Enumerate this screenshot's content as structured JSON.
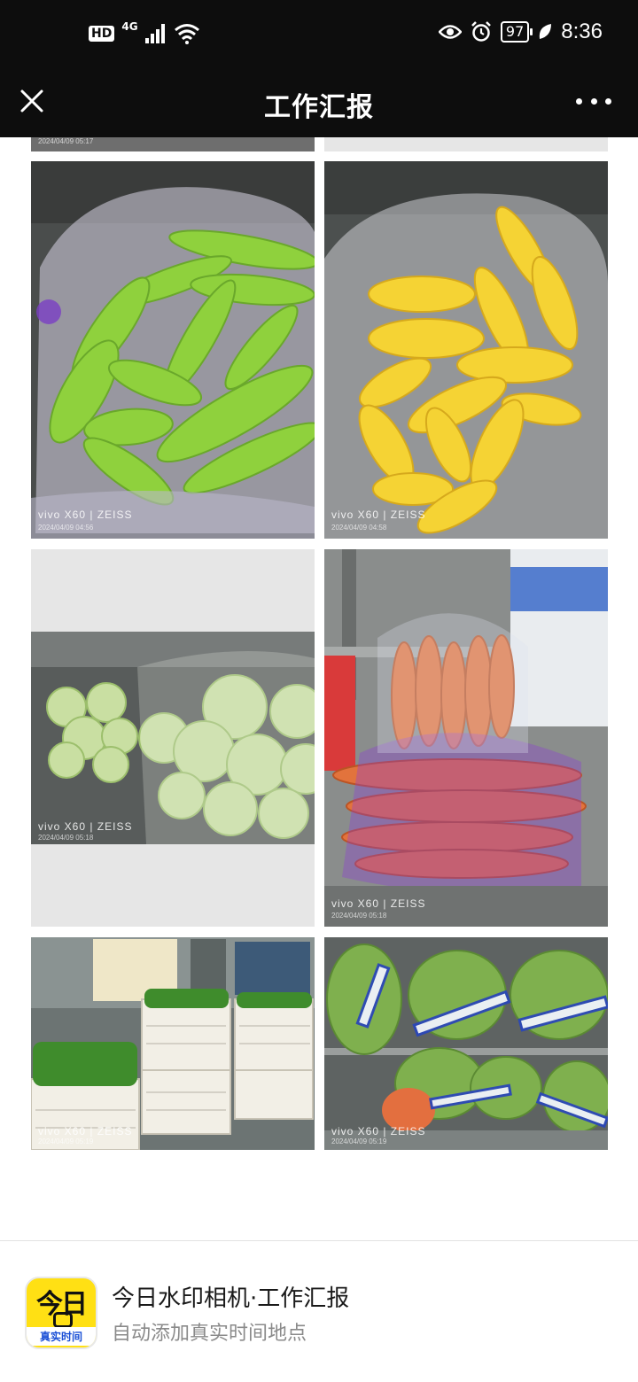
{
  "status_bar": {
    "hd": "HD",
    "network": "4G",
    "battery": "97",
    "time": "8:36"
  },
  "header": {
    "title": "工作汇报"
  },
  "photos": {
    "top_left_partial": {
      "date": "2024/04/09 05:17"
    },
    "bitter_melon": {
      "brand": "vivo X60 | ZEISS",
      "date": "2024/04/09 04:56"
    },
    "corn": {
      "brand": "vivo X60 | ZEISS",
      "date": "2024/04/09 04:58"
    },
    "cabbage": {
      "brand": "vivo X60 | ZEISS",
      "date": "2024/04/09 05:18"
    },
    "carrots": {
      "brand": "vivo X60 | ZEISS",
      "date": "2024/04/09 05:18"
    },
    "greens_baskets": {
      "brand": "vivo X60 | ZEISS",
      "date": "2024/04/09 05:19"
    },
    "greens_bags": {
      "brand": "vivo X60 | ZEISS",
      "date": "2024/04/09 05:19"
    }
  },
  "footer": {
    "icon_big": "今日",
    "icon_small": "真实时间",
    "app_name": "今日水印相机·工作汇报",
    "app_desc": "自动添加真实时间地点"
  },
  "colors": {
    "bar_bg": "#0d0d0d",
    "accent_yellow": "#ffe014",
    "icon_blue": "#1a4fd6"
  }
}
